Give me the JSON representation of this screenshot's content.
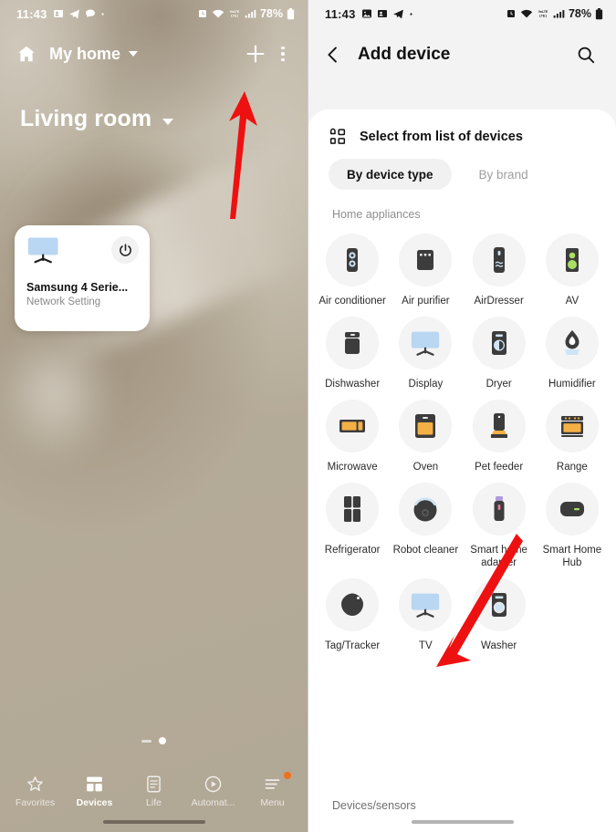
{
  "left": {
    "status_bar": {
      "time": "11:43",
      "left_icons": [
        "contacts-icon",
        "telegram-icon",
        "message-icon",
        "dot-icon"
      ],
      "right_icons": [
        "alarm-icon",
        "wifi-icon",
        "volte-icon",
        "signal-icon"
      ],
      "battery_percent": "78%",
      "battery_icon": "battery-icon"
    },
    "header": {
      "home_icon": "home-icon",
      "title": "My home",
      "caret_icon": "chevron-down-icon",
      "add_icon": "plus-icon",
      "more_icon": "more-vertical-icon"
    },
    "room": {
      "name": "Living room",
      "caret_icon": "chevron-down-icon"
    },
    "device_card": {
      "icon": "tv-icon",
      "power_icon": "power-icon",
      "name": "Samsung 4 Serie...",
      "status": "Network Setting"
    },
    "page_indicator": {
      "dash": "page-dash",
      "dot": "page-dot-active"
    },
    "bottom_nav": [
      {
        "label": "Favorites",
        "icon": "star-icon",
        "active": false,
        "badge": false
      },
      {
        "label": "Devices",
        "icon": "devices-grid-icon",
        "active": true,
        "badge": false
      },
      {
        "label": "Life",
        "icon": "life-list-icon",
        "active": false,
        "badge": false
      },
      {
        "label": "Automat...",
        "icon": "play-circle-icon",
        "active": false,
        "badge": false
      },
      {
        "label": "Menu",
        "icon": "menu-lines-icon",
        "active": false,
        "badge": true
      }
    ]
  },
  "right": {
    "status_bar": {
      "time": "11:43",
      "left_icons": [
        "gallery-icon",
        "contacts-icon",
        "telegram-icon",
        "dot-icon"
      ],
      "right_icons": [
        "alarm-icon",
        "wifi-icon",
        "volte-icon",
        "signal-icon"
      ],
      "battery_percent": "78%",
      "battery_icon": "battery-icon"
    },
    "header": {
      "back_icon": "chevron-left-icon",
      "title": "Add device",
      "search_icon": "search-icon"
    },
    "sheet": {
      "list_icon": "grid-list-icon",
      "title": "Select from list of devices",
      "tabs": [
        {
          "label": "By device type",
          "active": true
        },
        {
          "label": "By brand",
          "active": false
        }
      ],
      "section_label": "Home appliances",
      "devices": [
        {
          "label": "Air conditioner",
          "icon": "air-conditioner-icon"
        },
        {
          "label": "Air purifier",
          "icon": "air-purifier-icon"
        },
        {
          "label": "AirDresser",
          "icon": "airdresser-icon"
        },
        {
          "label": "AV",
          "icon": "av-speaker-icon"
        },
        {
          "label": "Dishwasher",
          "icon": "dishwasher-icon"
        },
        {
          "label": "Display",
          "icon": "display-icon"
        },
        {
          "label": "Dryer",
          "icon": "dryer-icon"
        },
        {
          "label": "Humidifier",
          "icon": "humidifier-icon"
        },
        {
          "label": "Microwave",
          "icon": "microwave-icon"
        },
        {
          "label": "Oven",
          "icon": "oven-icon"
        },
        {
          "label": "Pet feeder",
          "icon": "pet-feeder-icon"
        },
        {
          "label": "Range",
          "icon": "range-icon"
        },
        {
          "label": "Refrigerator",
          "icon": "refrigerator-icon"
        },
        {
          "label": "Robot cleaner",
          "icon": "robot-cleaner-icon"
        },
        {
          "label": "Smart home adapter",
          "icon": "smart-home-adapter-icon"
        },
        {
          "label": "Smart Home Hub",
          "icon": "smart-home-hub-icon"
        },
        {
          "label": "Tag/Tracker",
          "icon": "tag-tracker-icon"
        },
        {
          "label": "TV",
          "icon": "tv-icon"
        },
        {
          "label": "Washer",
          "icon": "washer-icon"
        }
      ],
      "next_section_label": "Devices/sensors"
    }
  },
  "annotations": {
    "arrow_color": "#EE1111",
    "arrow_1": "arrow-pointing-to-add-button",
    "arrow_2": "arrow-pointing-to-tv-device"
  }
}
